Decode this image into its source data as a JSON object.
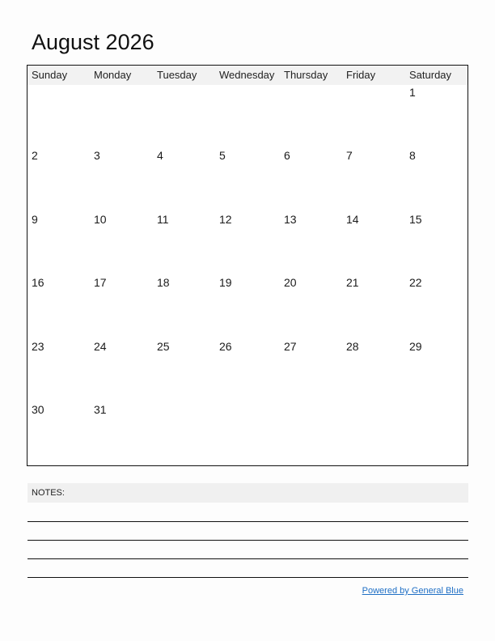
{
  "title": "August 2026",
  "weekdays": [
    "Sunday",
    "Monday",
    "Tuesday",
    "Wednesday",
    "Thursday",
    "Friday",
    "Saturday"
  ],
  "weeks": [
    [
      "",
      "",
      "",
      "",
      "",
      "",
      "1"
    ],
    [
      "2",
      "3",
      "4",
      "5",
      "6",
      "7",
      "8"
    ],
    [
      "9",
      "10",
      "11",
      "12",
      "13",
      "14",
      "15"
    ],
    [
      "16",
      "17",
      "18",
      "19",
      "20",
      "21",
      "22"
    ],
    [
      "23",
      "24",
      "25",
      "26",
      "27",
      "28",
      "29"
    ],
    [
      "30",
      "31",
      "",
      "",
      "",
      "",
      ""
    ]
  ],
  "notes": {
    "label": "NOTES:",
    "line_count": 4
  },
  "footer": {
    "powered_by": "Powered by General Blue"
  },
  "colors": {
    "link": "#1f6fc5",
    "header_band": "#f2f2f2"
  }
}
